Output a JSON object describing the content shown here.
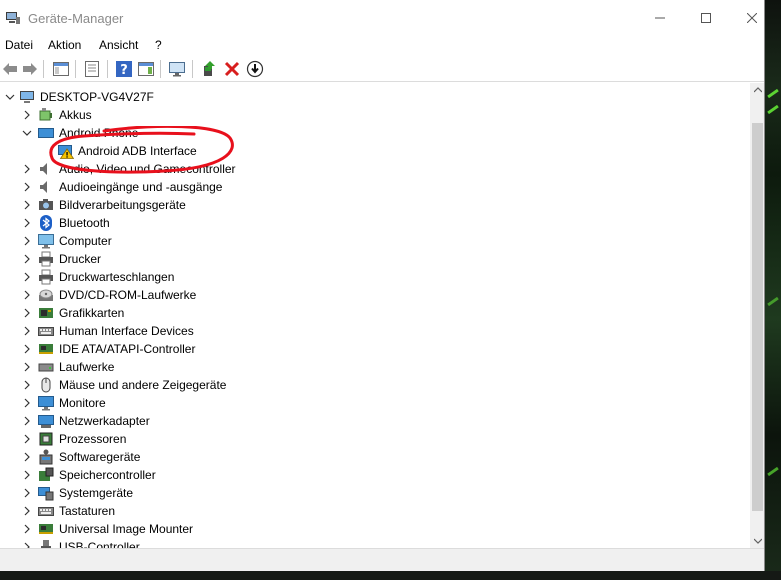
{
  "window": {
    "title": "Geräte-Manager"
  },
  "menu": {
    "items": [
      "Datei",
      "Aktion",
      "Ansicht",
      "?"
    ]
  },
  "tree": {
    "root": "DESKTOP-VG4V27F",
    "nodes": [
      {
        "label": "Akkus",
        "icon": "battery-icon",
        "expanded": false
      },
      {
        "label": "Android Phone",
        "icon": "phone-icon",
        "expanded": true
      },
      {
        "label": "Android ADB Interface",
        "icon": "warning-device-icon",
        "child": true
      },
      {
        "label": "Audio, Video und Gamecontroller",
        "icon": "speaker-icon",
        "expanded": false
      },
      {
        "label": "Audioeingänge und -ausgänge",
        "icon": "speaker-icon",
        "expanded": false
      },
      {
        "label": "Bildverarbeitungsgeräte",
        "icon": "camera-icon",
        "expanded": false
      },
      {
        "label": "Bluetooth",
        "icon": "bluetooth-icon",
        "expanded": false
      },
      {
        "label": "Computer",
        "icon": "monitor-icon",
        "expanded": false
      },
      {
        "label": "Drucker",
        "icon": "printer-icon",
        "expanded": false
      },
      {
        "label": "Druckwarteschlangen",
        "icon": "printer-icon",
        "expanded": false
      },
      {
        "label": "DVD/CD-ROM-Laufwerke",
        "icon": "disc-icon",
        "expanded": false
      },
      {
        "label": "Grafikkarten",
        "icon": "display-adapter-icon",
        "expanded": false
      },
      {
        "label": "Human Interface Devices",
        "icon": "keyboard-icon",
        "expanded": false
      },
      {
        "label": "IDE ATA/ATAPI-Controller",
        "icon": "controller-icon",
        "expanded": false
      },
      {
        "label": "Laufwerke",
        "icon": "drive-icon",
        "expanded": false
      },
      {
        "label": "Mäuse und andere Zeigegeräte",
        "icon": "mouse-icon",
        "expanded": false
      },
      {
        "label": "Monitore",
        "icon": "monitor-icon",
        "expanded": false
      },
      {
        "label": "Netzwerkadapter",
        "icon": "network-icon",
        "expanded": false
      },
      {
        "label": "Prozessoren",
        "icon": "processor-icon",
        "expanded": false
      },
      {
        "label": "Softwaregeräte",
        "icon": "software-device-icon",
        "expanded": false
      },
      {
        "label": "Speichercontroller",
        "icon": "storage-controller-icon",
        "expanded": false
      },
      {
        "label": "Systemgeräte",
        "icon": "system-device-icon",
        "expanded": false
      },
      {
        "label": "Tastaturen",
        "icon": "keyboard-icon",
        "expanded": false
      },
      {
        "label": "Universal Image Mounter",
        "icon": "controller-icon",
        "expanded": false
      },
      {
        "label": "USB-Controller",
        "icon": "usb-icon",
        "expanded": false
      }
    ]
  },
  "annotation_color": "#e8101c"
}
